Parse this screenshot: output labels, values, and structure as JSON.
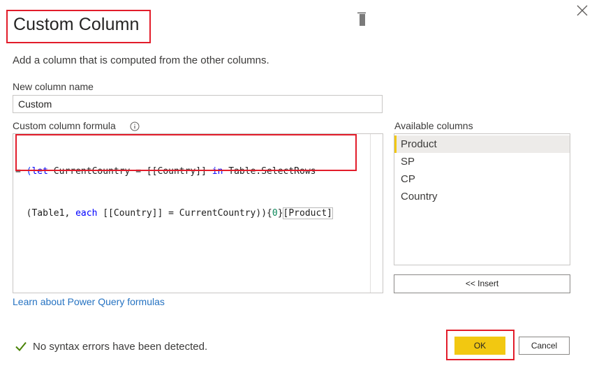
{
  "dialog": {
    "title": "Custom Column",
    "subtitle": "Add a column that is computed from the other columns.",
    "close_icon": "close-icon"
  },
  "new_column": {
    "label": "New column name",
    "value": "Custom"
  },
  "formula": {
    "label": "Custom column formula",
    "info_icon": "info-icon",
    "tokens_line1": [
      {
        "text": "= ",
        "kind": "plain"
      },
      {
        "text": "(",
        "kind": "paren"
      },
      {
        "text": "let",
        "kind": "kw"
      },
      {
        "text": " CurrentCountry = [[Country]] ",
        "kind": "plain"
      },
      {
        "text": "in",
        "kind": "kw"
      },
      {
        "text": " Table.SelectRows",
        "kind": "plain"
      }
    ],
    "tokens_line2": [
      {
        "text": "  (Table1, ",
        "kind": "plain"
      },
      {
        "text": "each",
        "kind": "kw"
      },
      {
        "text": " [[Country]] = CurrentCountry))",
        "kind": "plain"
      },
      {
        "text": "{",
        "kind": "plain"
      },
      {
        "text": "0",
        "kind": "num"
      },
      {
        "text": "}",
        "kind": "plain"
      },
      {
        "text": "[Product]",
        "kind": "hl"
      }
    ]
  },
  "available_columns": {
    "label": "Available columns",
    "items": [
      "Product",
      "SP",
      "CP",
      "Country"
    ],
    "selected_index": 0,
    "insert_label": "<< Insert"
  },
  "learn_link": "Learn about Power Query formulas",
  "status": {
    "text": "No syntax errors have been detected.",
    "icon": "check-icon"
  },
  "buttons": {
    "ok": "OK",
    "cancel": "Cancel"
  },
  "colors": {
    "accent": "#f2c811",
    "highlight_box": "#e21c2a",
    "link": "#2673c2",
    "check": "#498205"
  }
}
